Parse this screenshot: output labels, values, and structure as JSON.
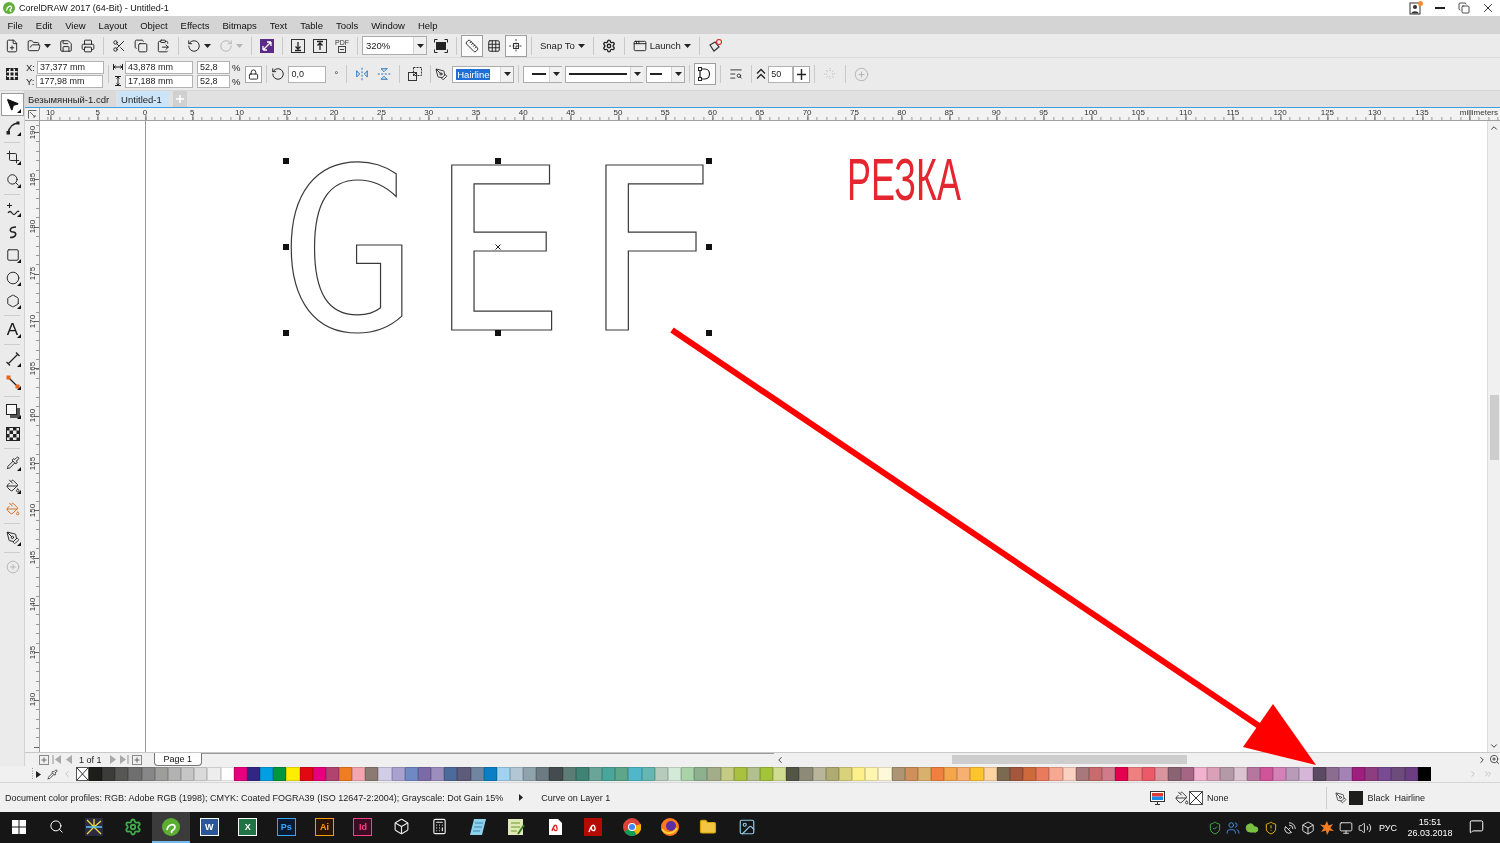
{
  "window": {
    "title": "CorelDRAW 2017 (64-Bit) - Untitled-1"
  },
  "menu": [
    {
      "label": "File"
    },
    {
      "label": "Edit"
    },
    {
      "label": "View"
    },
    {
      "label": "Layout"
    },
    {
      "label": "Object"
    },
    {
      "label": "Effects"
    },
    {
      "label": "Bitmaps"
    },
    {
      "label": "Text"
    },
    {
      "label": "Table"
    },
    {
      "label": "Tools"
    },
    {
      "label": "Window"
    },
    {
      "label": "Help"
    }
  ],
  "standard_toolbar": {
    "undo": {
      "disabled": false
    },
    "redo": {
      "disabled": true
    },
    "pdf_badge": "PDF",
    "zoom_level": "320%",
    "view_toggles": [
      {
        "pressed": true
      },
      {
        "pressed": false
      },
      {
        "pressed": true
      }
    ],
    "snap_to": "Snap To",
    "launch": "Launch"
  },
  "property_bar": {
    "position": [
      {
        "label": "X:",
        "value": "37,377 mm"
      },
      {
        "label": "Y:",
        "value": "177,98 mm"
      }
    ],
    "size": [
      {
        "value": "43,878 mm"
      },
      {
        "value": "17,188 mm"
      }
    ],
    "scale": [
      {
        "value": "52,8",
        "unit": "%"
      },
      {
        "value": "52,8",
        "unit": "%"
      }
    ],
    "rotation": {
      "value": "0,0",
      "unit": "°"
    },
    "outline_width": {
      "value": "Hairline",
      "highlighted": true
    },
    "smoothing": "50"
  },
  "document_tabs": [
    {
      "label": "Безымянный-1.cdr",
      "selected": false
    },
    {
      "label": "Untitled-1",
      "selected": true
    }
  ],
  "toolbox": {
    "groups": [
      [
        {
          "selected": true
        },
        {
          "selected": false
        }
      ],
      [
        {
          "selected": false
        },
        {
          "selected": false
        }
      ],
      [
        {
          "selected": false
        },
        {
          "selected": false
        },
        {
          "selected": false
        },
        {
          "selected": false
        },
        {
          "selected": false
        }
      ],
      [
        {
          "selected": false,
          "glyph": "A"
        }
      ],
      [
        {
          "selected": false
        },
        {
          "selected": false
        }
      ],
      [
        {
          "selected": false
        },
        {
          "selected": false
        }
      ],
      [
        {
          "selected": false
        },
        {
          "selected": false
        },
        {
          "selected": false
        }
      ],
      [
        {
          "selected": false
        }
      ]
    ]
  },
  "horizontal_ruler": {
    "labels": [
      "10",
      "5",
      "0",
      "5",
      "10",
      "15",
      "20",
      "25",
      "30",
      "35",
      "40",
      "45",
      "50",
      "55",
      "60",
      "65",
      "70",
      "75",
      "80",
      "85",
      "90",
      "95",
      "100",
      "105",
      "110",
      "115",
      "120",
      "125",
      "130",
      "135"
    ],
    "unit": "millimeters"
  },
  "vertical_ruler": {
    "labels": [
      "190",
      "185",
      "180",
      "175",
      "170",
      "165",
      "160",
      "155",
      "150",
      "145",
      "140",
      "135",
      "130"
    ]
  },
  "canvas": {
    "curves": {
      "letters": "GEF",
      "selected": true
    },
    "text": "РЕЗКА"
  },
  "page_navigator": {
    "position": "1 of 1",
    "page_tab": "Page 1"
  },
  "palette": {
    "colors": [
      {
        "color": "#1d1d1b"
      },
      {
        "color": "#3c3c3b"
      },
      {
        "color": "#575756"
      },
      {
        "color": "#706f6f"
      },
      {
        "color": "#878787"
      },
      {
        "color": "#9d9d9c"
      },
      {
        "color": "#b2b2b2"
      },
      {
        "color": "#c6c6c6"
      },
      {
        "color": "#dadada"
      },
      {
        "color": "#ededed"
      },
      {
        "color": "#ffffff"
      },
      {
        "color": "#e6007e"
      },
      {
        "color": "#312783"
      },
      {
        "color": "#009fe3"
      },
      {
        "color": "#009640"
      },
      {
        "color": "#ffed00"
      },
      {
        "color": "#e30613"
      },
      {
        "color": "#e5007d"
      },
      {
        "color": "#b0446f"
      },
      {
        "color": "#ef7d22"
      },
      {
        "color": "#f4a6b0"
      },
      {
        "color": "#8a7a72"
      },
      {
        "color": "#d1cde6"
      },
      {
        "color": "#a9a2d1"
      },
      {
        "color": "#6f89c4"
      },
      {
        "color": "#7c6aa8"
      },
      {
        "color": "#9c8dbd"
      },
      {
        "color": "#4d6a9c"
      },
      {
        "color": "#5e5a7a"
      },
      {
        "color": "#6f85a0"
      },
      {
        "color": "#0b7fc3"
      },
      {
        "color": "#9fd3f0"
      },
      {
        "color": "#b2c6d4"
      },
      {
        "color": "#8fa3ad"
      },
      {
        "color": "#6c7b82"
      },
      {
        "color": "#444c4f"
      },
      {
        "color": "#5c7d75"
      },
      {
        "color": "#3e8374"
      },
      {
        "color": "#6aa59a"
      },
      {
        "color": "#49a69a"
      },
      {
        "color": "#5fa58a"
      },
      {
        "color": "#4fb7c9"
      },
      {
        "color": "#66b7b2"
      },
      {
        "color": "#b7cbbd"
      },
      {
        "color": "#d4ead9"
      },
      {
        "color": "#a9d2a9"
      },
      {
        "color": "#8db08f"
      },
      {
        "color": "#a3ad8a"
      },
      {
        "color": "#c4cc84"
      },
      {
        "color": "#aac13f"
      },
      {
        "color": "#b2bf8f"
      },
      {
        "color": "#a3c33a"
      },
      {
        "color": "#d0dc8e"
      },
      {
        "color": "#535548"
      },
      {
        "color": "#8d8b77"
      },
      {
        "color": "#b8b59a"
      },
      {
        "color": "#b0ab73"
      },
      {
        "color": "#d9d17b"
      },
      {
        "color": "#fdf08a"
      },
      {
        "color": "#fff4b0"
      },
      {
        "color": "#fff9d9"
      },
      {
        "color": "#ad9574"
      },
      {
        "color": "#cf8f5b"
      },
      {
        "color": "#d9b06c"
      },
      {
        "color": "#f08040"
      },
      {
        "color": "#f6a64a"
      },
      {
        "color": "#f8b072"
      },
      {
        "color": "#fdc52d"
      },
      {
        "color": "#fcd3a1"
      },
      {
        "color": "#7c6a50"
      },
      {
        "color": "#a5573d"
      },
      {
        "color": "#cc6a3c"
      },
      {
        "color": "#ea7a5e"
      },
      {
        "color": "#f6a892"
      },
      {
        "color": "#fad0c0"
      },
      {
        "color": "#a8787a"
      },
      {
        "color": "#c86b6b"
      },
      {
        "color": "#cf7b8b"
      },
      {
        "color": "#e4004f"
      },
      {
        "color": "#f08080"
      },
      {
        "color": "#ec5a6a"
      },
      {
        "color": "#d9959d"
      },
      {
        "color": "#8b6474"
      },
      {
        "color": "#a76585"
      },
      {
        "color": "#f2b2d0"
      },
      {
        "color": "#d9a0b8"
      },
      {
        "color": "#b49aa7"
      },
      {
        "color": "#dcc3d0"
      },
      {
        "color": "#b5779f"
      },
      {
        "color": "#d0549a"
      },
      {
        "color": "#d481b8"
      },
      {
        "color": "#b79bb8"
      },
      {
        "color": "#d7b5d8"
      },
      {
        "color": "#5c4a63"
      },
      {
        "color": "#8b6d92"
      },
      {
        "color": "#a482b5"
      },
      {
        "color": "#9e1f7e"
      },
      {
        "color": "#8e3d80"
      },
      {
        "color": "#7a4a93"
      },
      {
        "color": "#6b4c7a"
      },
      {
        "color": "#6b3e83"
      },
      {
        "color": "#000000"
      }
    ]
  },
  "status_bar": {
    "color_profiles": "Document color profiles: RGB: Adobe RGB (1998); CMYK: Coated FOGRA39 (ISO 12647-2:2004); Grayscale: Dot Gain 15%",
    "object_info": "Curve on Layer 1",
    "fill": "None",
    "outline_color": "Black",
    "outline_width": "Hairline"
  },
  "taskbar": {
    "apps": [
      {
        "selected": false
      },
      {
        "selected": false
      },
      {
        "selected": true
      },
      {
        "selected": false,
        "glyph": "W"
      },
      {
        "selected": false,
        "glyph": "X"
      },
      {
        "selected": false,
        "glyph": "Ps"
      },
      {
        "selected": false,
        "glyph": "Ai"
      },
      {
        "selected": false,
        "glyph": "Id"
      },
      {
        "selected": false
      },
      {
        "selected": false
      },
      {
        "selected": false
      },
      {
        "selected": false
      },
      {
        "selected": false
      },
      {
        "selected": false
      },
      {
        "selected": false
      },
      {
        "selected": false
      },
      {
        "selected": false
      },
      {
        "selected": false
      }
    ],
    "language": "РУС",
    "time": "15:51",
    "date": "26.03.2018"
  }
}
